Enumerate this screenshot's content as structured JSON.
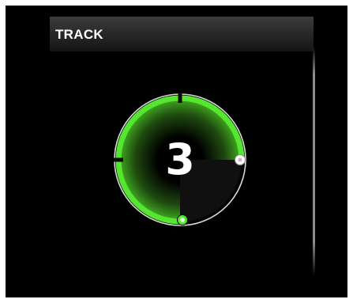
{
  "panel": {
    "title": "TRACK"
  },
  "dial": {
    "value": "3",
    "progress": 0.75,
    "colors": {
      "arc": "#55e630",
      "arc_dark": "#2f9a14",
      "ring": "#ffffff",
      "background": "#000000"
    }
  }
}
